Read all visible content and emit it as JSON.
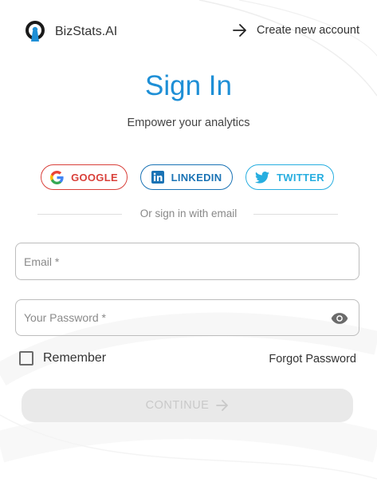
{
  "header": {
    "brand_name": "BizStats.AI",
    "create_account_label": "Create new account"
  },
  "signin": {
    "title": "Sign In",
    "subtitle": "Empower your analytics"
  },
  "social": {
    "google_label": "GOOGLE",
    "linkedin_label": "LINKEDIN",
    "twitter_label": "TWITTER",
    "divider_text": "Or sign in with email"
  },
  "form": {
    "email": {
      "value": "",
      "placeholder": "Email *"
    },
    "password": {
      "value": "",
      "placeholder": "Your Password *"
    },
    "remember_label": "Remember",
    "remember_checked": false,
    "forgot_label": "Forgot Password",
    "continue_label": "CONTINUE",
    "continue_enabled": false
  },
  "colors": {
    "accent": "#1e8fd6",
    "google": "#d9403a",
    "linkedin": "#1a73b5",
    "twitter": "#27aee0",
    "disabled_bg": "#e9e9e9"
  },
  "icons": {
    "brand": "keyhole-logo-icon",
    "create_account": "arrow-right-icon",
    "google": "google-g-icon",
    "linkedin": "linkedin-icon",
    "twitter": "twitter-bird-icon",
    "password_toggle": "eye-icon",
    "continue": "arrow-right-icon"
  }
}
